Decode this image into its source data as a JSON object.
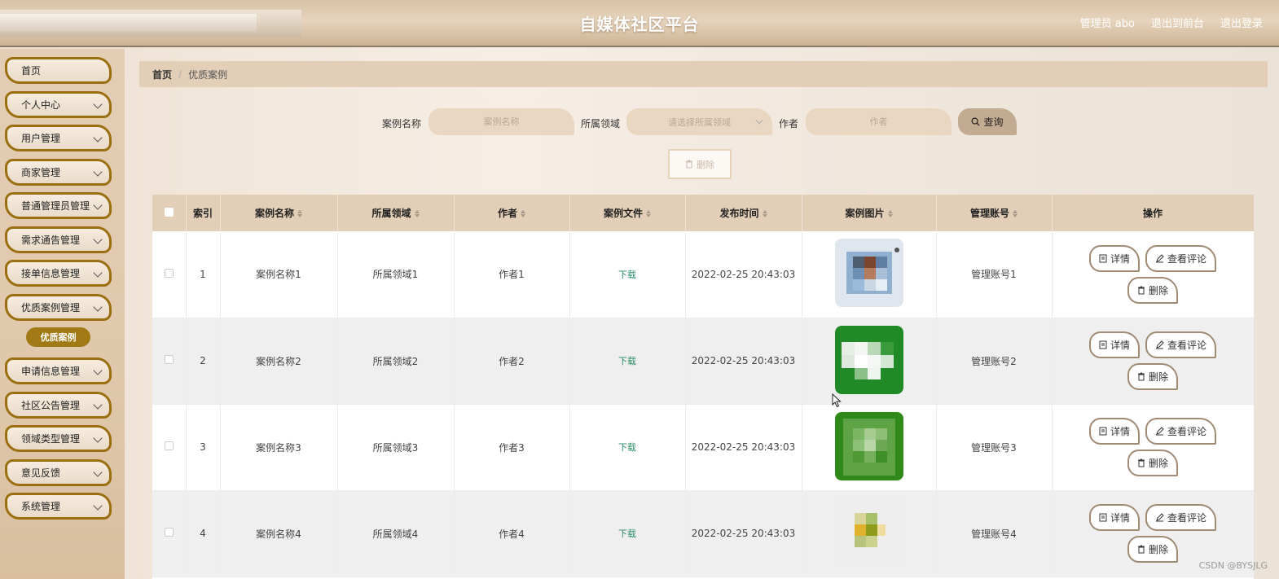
{
  "header": {
    "title": "自媒体社区平台",
    "admin": "管理员 abo",
    "to_front": "退出到前台",
    "logout": "退出登录"
  },
  "sidebar": {
    "items": [
      {
        "label": "首页",
        "has_children": false
      },
      {
        "label": "个人中心",
        "has_children": true
      },
      {
        "label": "用户管理",
        "has_children": true
      },
      {
        "label": "商家管理",
        "has_children": true
      },
      {
        "label": "普通管理员管理",
        "has_children": true
      },
      {
        "label": "需求通告管理",
        "has_children": true
      },
      {
        "label": "接单信息管理",
        "has_children": true
      },
      {
        "label": "优质案例管理",
        "has_children": true
      },
      {
        "label": "申请信息管理",
        "has_children": true
      },
      {
        "label": "社区公告管理",
        "has_children": true
      },
      {
        "label": "领域类型管理",
        "has_children": true
      },
      {
        "label": "意见反馈",
        "has_children": true
      },
      {
        "label": "系统管理",
        "has_children": true
      }
    ],
    "active_sub": "优质案例"
  },
  "breadcrumb": {
    "home": "首页",
    "separator": "/",
    "current": "优质案例"
  },
  "search": {
    "name_label": "案例名称",
    "name_placeholder": "案例名称",
    "domain_label": "所属领域",
    "domain_placeholder": "请选择所属领域",
    "author_label": "作者",
    "author_placeholder": "作者",
    "query_button": "查询"
  },
  "toolbar": {
    "delete_label": "删除"
  },
  "table": {
    "columns": [
      "索引",
      "案例名称",
      "所属领域",
      "作者",
      "案例文件",
      "发布时间",
      "案例图片",
      "管理账号",
      "操作"
    ],
    "rows": [
      {
        "index": "1",
        "name": "案例名称1",
        "domain": "所属领域1",
        "author": "作者1",
        "file": "下载",
        "time": "2022-02-25 20:43:03",
        "account": "管理账号1",
        "image": "pixelated-photo"
      },
      {
        "index": "2",
        "name": "案例名称2",
        "domain": "所属领域2",
        "author": "作者2",
        "file": "下载",
        "time": "2022-02-25 20:43:03",
        "account": "管理账号2",
        "image": "pixelated-green"
      },
      {
        "index": "3",
        "name": "案例名称3",
        "domain": "所属领域3",
        "author": "作者3",
        "file": "下载",
        "time": "2022-02-25 20:43:03",
        "account": "管理账号3",
        "image": "pixelated-green-dark"
      },
      {
        "index": "4",
        "name": "案例名称4",
        "domain": "所属领域4",
        "author": "作者4",
        "file": "下载",
        "time": "2022-02-25 20:43:03",
        "account": "管理账号4",
        "image": "pixelated-yellow"
      }
    ],
    "actions": {
      "detail": "详情",
      "comments": "查看评论",
      "delete": "删除"
    }
  },
  "watermark": "CSDN @BYSJLG",
  "colors": {
    "accent": "#9b6f10",
    "active_sub": "#a27a15",
    "header_bg": "#d8c1a4",
    "download_link": "#2a8a63"
  }
}
